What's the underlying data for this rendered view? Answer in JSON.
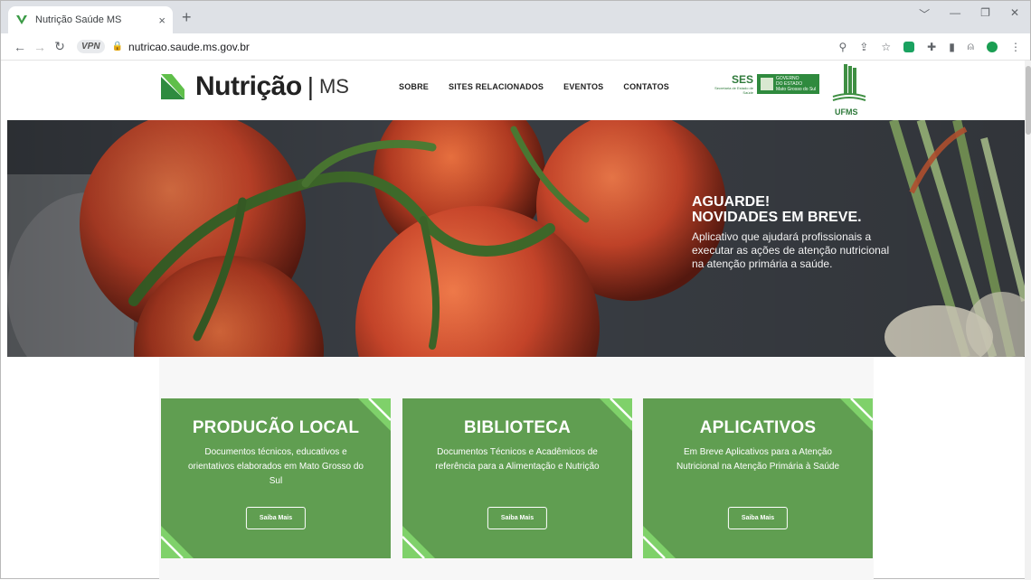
{
  "browser": {
    "tab_title": "Nutrição Saúde MS",
    "tab_close": "×",
    "new_tab": "+",
    "url": "nutricao.saude.ms.gov.br",
    "vpn_label": "VPN",
    "window_controls": [
      "﹀",
      "—",
      "❐",
      "✕"
    ]
  },
  "site": {
    "logo_name": "Nutrição",
    "logo_sep": "|",
    "logo_suffix": "MS",
    "menu": [
      "SOBRE",
      "SITES RELACIONADOS",
      "EVENTOS",
      "CONTATOS"
    ],
    "ses": {
      "abbr": "SES",
      "full": "Secretaria de Estado de Saúde",
      "gov": [
        "GOVERNO",
        "DO ESTADO",
        "Mato Grosso do Sul"
      ]
    },
    "ufms": "UFMS"
  },
  "hero": {
    "title_line1": "AGUARDE!",
    "title_line2": "NOVIDADES EM BREVE.",
    "description": "Aplicativo que ajudará profissionais a executar as ações de atenção nutricional na atenção primária a saúde."
  },
  "cards": [
    {
      "title": "PRODUCÃO LOCAL",
      "description": "Documentos técnicos, educativos e orientativos elaborados em Mato Grosso do Sul",
      "button": "Saiba Mais"
    },
    {
      "title": "BIBLIOTECA",
      "description": "Documentos Técnicos e Acadêmicos de referência para a Alimentação e Nutrição",
      "button": "Saiba Mais"
    },
    {
      "title": "APLICATIVOS",
      "description": "Em Breve Aplicativos para a Atenção Nutricional na Atenção Primária à Saúde",
      "button": "Saiba Mais"
    }
  ],
  "colors": {
    "brand_green": "#609e51",
    "accent_green": "#4caf50",
    "hero_dark": "#2e3238"
  }
}
